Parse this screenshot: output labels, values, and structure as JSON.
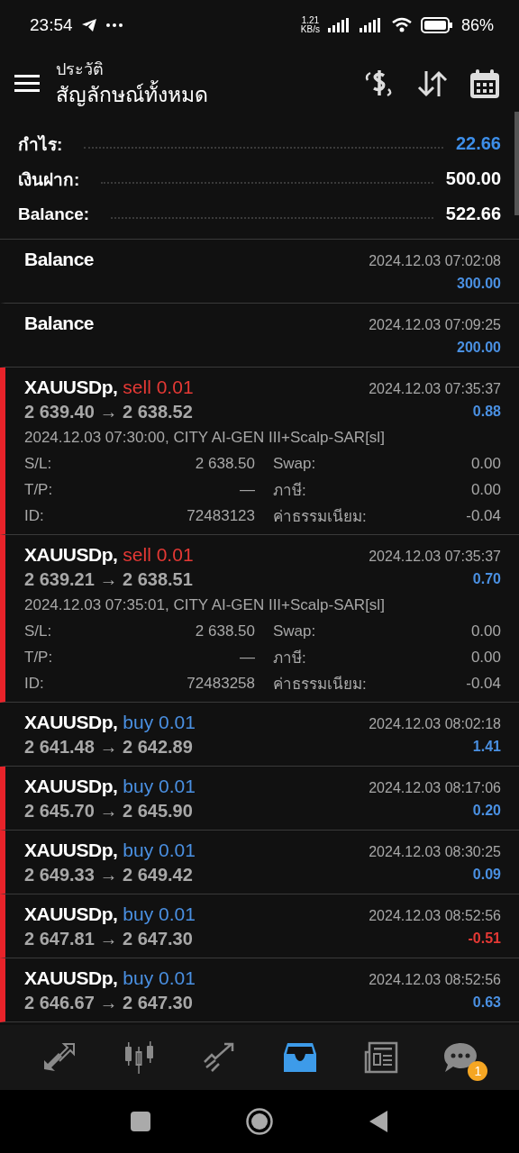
{
  "status_bar": {
    "time": "23:54",
    "speed_value": "1.21",
    "speed_unit": "KB/s",
    "battery": "86%"
  },
  "header": {
    "subtitle": "ประวัติ",
    "title": "สัญลักษณ์ทั้งหมด"
  },
  "summary": [
    {
      "label": "กำไร:",
      "value": "22.66",
      "highlight": true
    },
    {
      "label": "เงินฝาก:",
      "value": "500.00",
      "highlight": false
    },
    {
      "label": "Balance:",
      "value": "522.66",
      "highlight": false
    }
  ],
  "deals": [
    {
      "kind": "balance",
      "title": "Balance",
      "time": "2024.12.03 07:02:08",
      "profit": "300.00",
      "loss": false,
      "marked": false,
      "expanded": false
    },
    {
      "kind": "balance",
      "title": "Balance",
      "time": "2024.12.03 07:09:25",
      "profit": "200.00",
      "loss": false,
      "marked": false,
      "expanded": false
    },
    {
      "kind": "sell",
      "title": "XAUUSDp,",
      "order": "sell 0.01",
      "prices": "2 639.40 → 2 638.52",
      "time": "2024.12.03 07:35:37",
      "profit": "0.88",
      "loss": false,
      "marked": true,
      "expanded": true,
      "comment": "2024.12.03 07:30:00, CITY AI-GEN III+Scalp-SAR[sl]",
      "details": [
        {
          "l1": "S/L:",
          "v1": "2 638.50",
          "l2": "Swap:",
          "v2": "0.00"
        },
        {
          "l1": "T/P:",
          "v1": "—",
          "l2": "ภาษี:",
          "v2": "0.00"
        },
        {
          "l1": "ID:",
          "v1": "72483123",
          "l2": "ค่าธรรมเนียม:",
          "v2": "-0.04"
        }
      ]
    },
    {
      "kind": "sell",
      "title": "XAUUSDp,",
      "order": "sell 0.01",
      "prices": "2 639.21 → 2 638.51",
      "time": "2024.12.03 07:35:37",
      "profit": "0.70",
      "loss": false,
      "marked": true,
      "expanded": true,
      "comment": "2024.12.03 07:35:01, CITY AI-GEN III+Scalp-SAR[sl]",
      "details": [
        {
          "l1": "S/L:",
          "v1": "2 638.50",
          "l2": "Swap:",
          "v2": "0.00"
        },
        {
          "l1": "T/P:",
          "v1": "—",
          "l2": "ภาษี:",
          "v2": "0.00"
        },
        {
          "l1": "ID:",
          "v1": "72483258",
          "l2": "ค่าธรรมเนียม:",
          "v2": "-0.04"
        }
      ]
    },
    {
      "kind": "buy",
      "title": "XAUUSDp,",
      "order": "buy 0.01",
      "prices": "2 641.48 → 2 642.89",
      "time": "2024.12.03 08:02:18",
      "profit": "1.41",
      "loss": false,
      "marked": false,
      "expanded": false
    },
    {
      "kind": "buy",
      "title": "XAUUSDp,",
      "order": "buy 0.01",
      "prices": "2 645.70 → 2 645.90",
      "time": "2024.12.03 08:17:06",
      "profit": "0.20",
      "loss": false,
      "marked": true,
      "expanded": false
    },
    {
      "kind": "buy",
      "title": "XAUUSDp,",
      "order": "buy 0.01",
      "prices": "2 649.33 → 2 649.42",
      "time": "2024.12.03 08:30:25",
      "profit": "0.09",
      "loss": false,
      "marked": true,
      "expanded": false
    },
    {
      "kind": "buy",
      "title": "XAUUSDp,",
      "order": "buy 0.01",
      "prices": "2 647.81 → 2 647.30",
      "time": "2024.12.03 08:52:56",
      "profit": "-0.51",
      "loss": true,
      "marked": true,
      "expanded": false
    },
    {
      "kind": "buy",
      "title": "XAUUSDp,",
      "order": "buy 0.01",
      "prices": "2 646.67 → 2 647.30",
      "time": "2024.12.03 08:52:56",
      "profit": "0.63",
      "loss": false,
      "marked": true,
      "expanded": false
    }
  ],
  "bottom_nav": [
    {
      "selected": false
    },
    {
      "selected": false
    },
    {
      "selected": false
    },
    {
      "selected": true
    },
    {
      "selected": false
    },
    {
      "selected": false,
      "badge": "1"
    }
  ]
}
